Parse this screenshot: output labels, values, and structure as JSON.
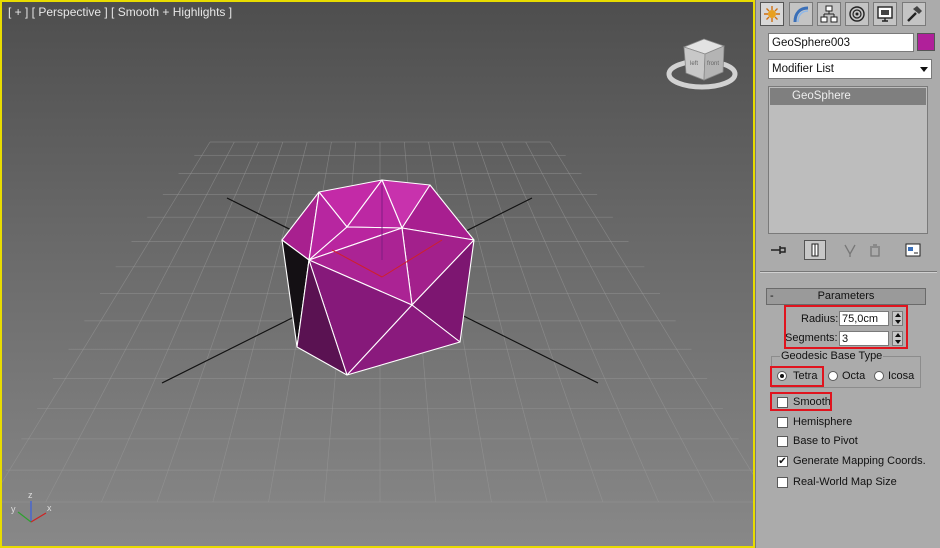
{
  "viewport": {
    "label": "[ + ] [ Perspective ] [ Smooth + Highlights ]",
    "viewcube": {
      "left": "left",
      "front": "front"
    },
    "axes": {
      "x": "x",
      "y": "y",
      "z": "z"
    },
    "object_color": "#b0209a",
    "border_color": "#e8dc00"
  },
  "command_panel": {
    "tabs": [
      {
        "name": "create-tab",
        "icon": "sun-star-icon",
        "active": true
      },
      {
        "name": "modify-tab",
        "icon": "bend-modify-icon",
        "active": false
      },
      {
        "name": "hierarchy-tab",
        "icon": "hierarchy-icon",
        "active": false
      },
      {
        "name": "motion-tab",
        "icon": "motion-icon",
        "active": false
      },
      {
        "name": "display-tab",
        "icon": "display-monitor-icon",
        "active": false
      },
      {
        "name": "utilities-tab",
        "icon": "hammer-icon",
        "active": false
      }
    ],
    "object_name": "GeoSphere003",
    "object_color": "#b0209a",
    "modifier_list": "Modifier List",
    "stack_items": [
      "GeoSphere"
    ],
    "stack_tools": [
      "pin-stack-icon",
      "show-end-result-icon",
      "make-unique-icon",
      "remove-modifier-icon",
      "configure-modifier-sets-icon"
    ]
  },
  "parameters": {
    "title": "Parameters",
    "collapse": "-",
    "radius_label": "Radius:",
    "radius_value": "75,0cm",
    "segments_label": "Segments:",
    "segments_value": "3",
    "base_type_title": "Geodesic Base Type",
    "base_types": [
      {
        "label": "Tetra",
        "selected": true
      },
      {
        "label": "Octa",
        "selected": false
      },
      {
        "label": "Icosa",
        "selected": false
      }
    ],
    "checkboxes": [
      {
        "label": "Smooth",
        "checked": false
      },
      {
        "label": "Hemisphere",
        "checked": false
      },
      {
        "label": "Base to Pivot",
        "checked": false
      },
      {
        "label": "Generate Mapping Coords.",
        "checked": true
      },
      {
        "label": "Real-World Map Size",
        "checked": false
      }
    ],
    "checked_mark": "✔",
    "highlight_color": "#e0141e"
  }
}
